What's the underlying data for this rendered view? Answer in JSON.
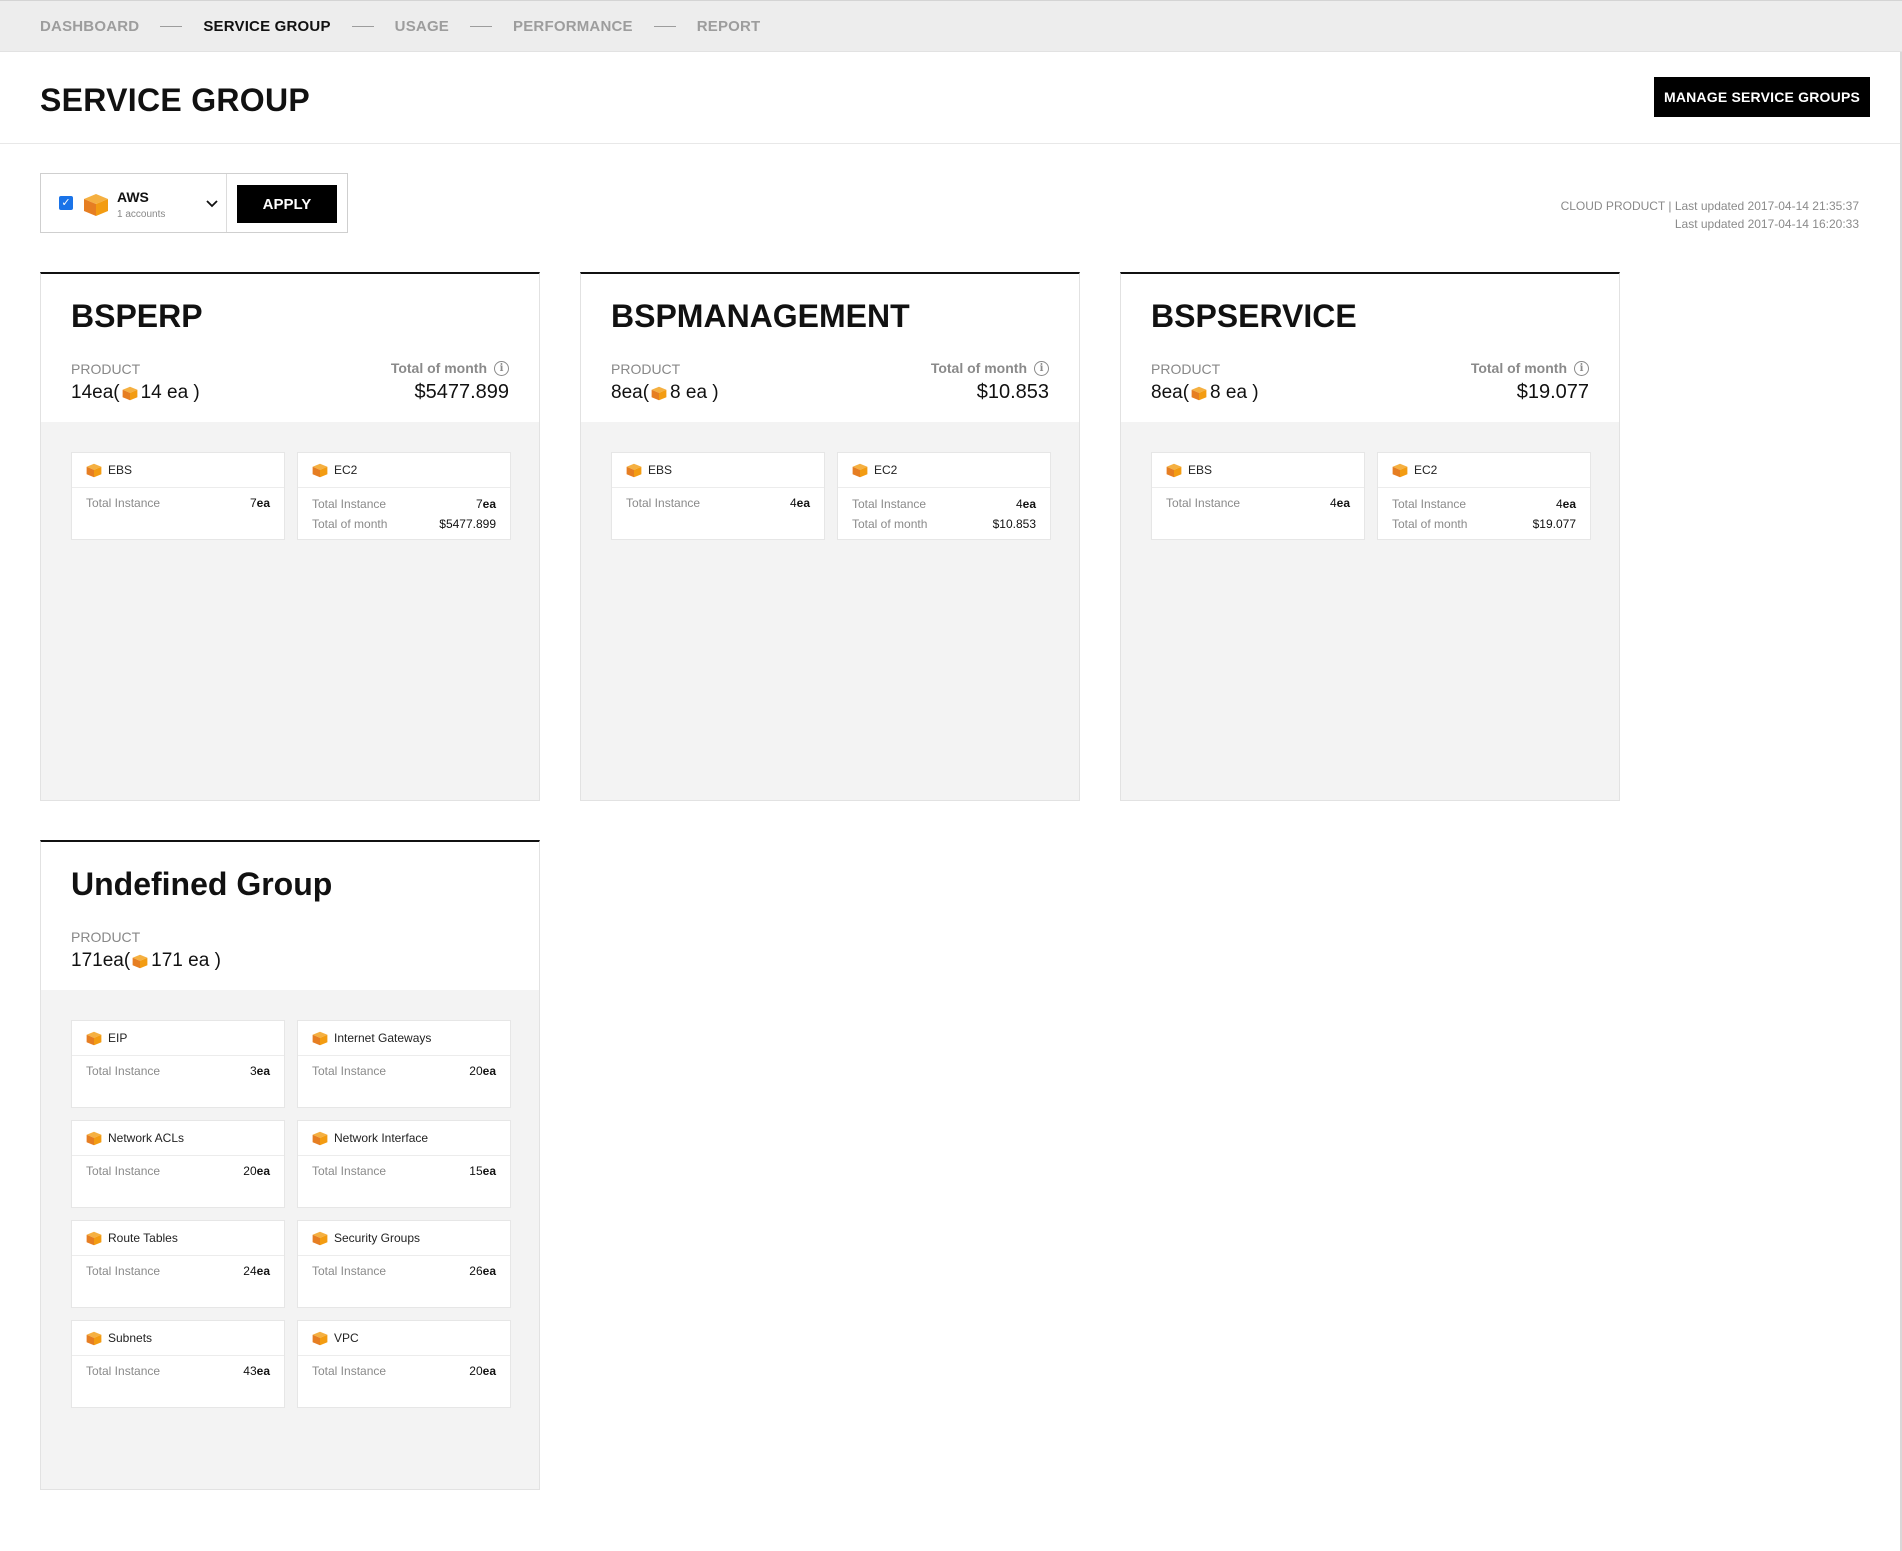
{
  "nav": {
    "steps": [
      "DASHBOARD",
      "SERVICE GROUP",
      "USAGE",
      "PERFORMANCE",
      "REPORT"
    ],
    "active": "SERVICE GROUP"
  },
  "page": {
    "title": "SERVICE GROUP",
    "manage_button": "MANAGE SERVICE GROUPS"
  },
  "filter": {
    "checked": true,
    "account_name": "AWS",
    "account_sub": "1 accounts",
    "apply_label": "APPLY"
  },
  "updated": {
    "line1": "CLOUD PRODUCT | Last updated 2017-04-14 21:35:37",
    "line2": "Last updated 2017-04-14 16:20:33"
  },
  "labels": {
    "product": "PRODUCT",
    "total_of_month": "Total of month",
    "total_instance": "Total Instance",
    "unit": "ea"
  },
  "groups": [
    {
      "name": "BSPERP",
      "product_total": "14ea(",
      "product_aws": "14 ea )",
      "total_of_month": "$5477.899",
      "services": [
        {
          "name": "EBS",
          "instances": "7",
          "month": ""
        },
        {
          "name": "EC2",
          "instances": "7",
          "month": "$5477.899"
        }
      ]
    },
    {
      "name": "BSPMANAGEMENT",
      "product_total": "8ea(",
      "product_aws": "8 ea )",
      "total_of_month": "$10.853",
      "services": [
        {
          "name": "EBS",
          "instances": "4",
          "month": ""
        },
        {
          "name": "EC2",
          "instances": "4",
          "month": "$10.853"
        }
      ]
    },
    {
      "name": "BSPSERVICE",
      "product_total": "8ea(",
      "product_aws": "8 ea )",
      "total_of_month": "$19.077",
      "services": [
        {
          "name": "EBS",
          "instances": "4",
          "month": ""
        },
        {
          "name": "EC2",
          "instances": "4",
          "month": "$19.077"
        }
      ]
    },
    {
      "name": "Undefined Group",
      "product_total": "171ea(",
      "product_aws": "171 ea )",
      "total_of_month": "",
      "services": [
        {
          "name": "EIP",
          "instances": "3",
          "month": ""
        },
        {
          "name": "Internet Gateways",
          "instances": "20",
          "month": ""
        },
        {
          "name": "Network ACLs",
          "instances": "20",
          "month": ""
        },
        {
          "name": "Network Interface",
          "instances": "15",
          "month": ""
        },
        {
          "name": "Route Tables",
          "instances": "24",
          "month": ""
        },
        {
          "name": "Security Groups",
          "instances": "26",
          "month": ""
        },
        {
          "name": "Subnets",
          "instances": "43",
          "month": ""
        },
        {
          "name": "VPC",
          "instances": "20",
          "month": ""
        }
      ]
    }
  ],
  "colors": {
    "aws_cube": "#f39c12",
    "checkbox": "#1a73e8",
    "button_bg": "#000000"
  },
  "icons": {
    "service": "aws-cube-icon",
    "info": "info-icon",
    "dropdown": "chevron-down-icon",
    "checkbox": "checkbox-icon"
  }
}
